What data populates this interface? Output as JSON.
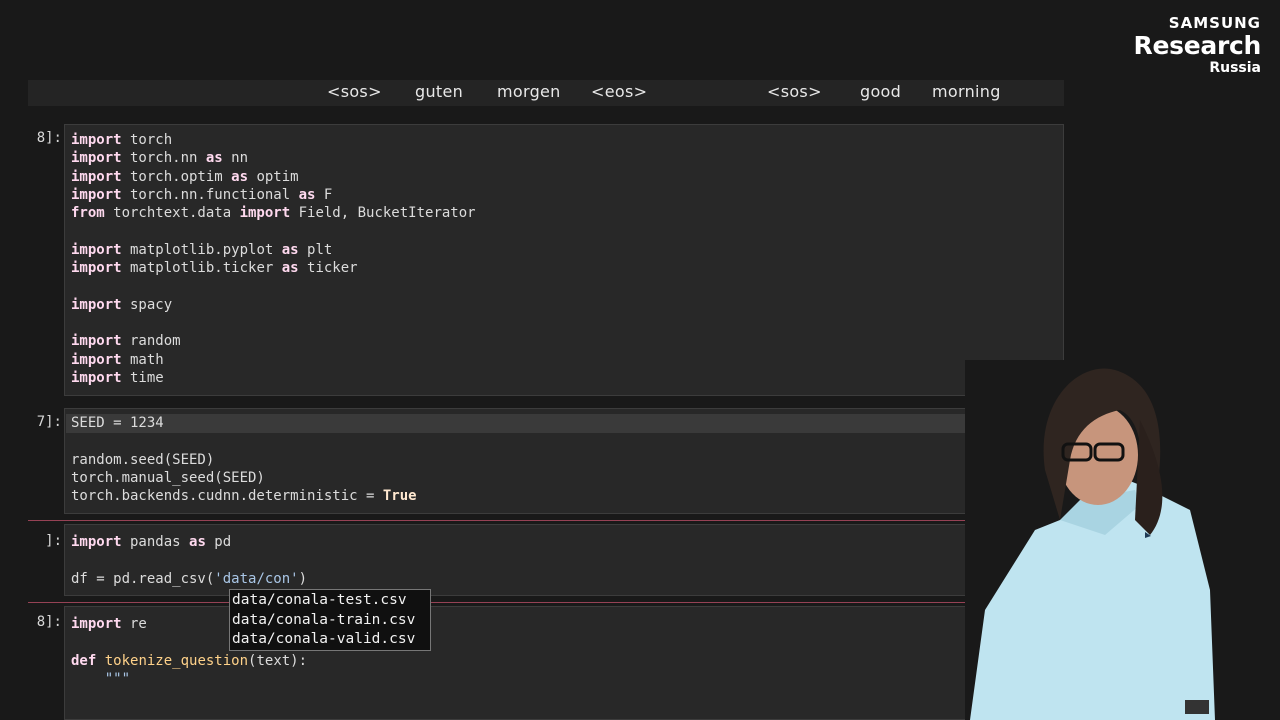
{
  "brand": {
    "line1": "SAMSUNG",
    "line2": "Research",
    "line3": "Russia"
  },
  "tokens": [
    "<sos>",
    "guten",
    "morgen",
    "<eos>",
    "<sos>",
    "good",
    "morning"
  ],
  "cells": [
    {
      "prompt": "8]:"
    },
    {
      "prompt": "7]:"
    },
    {
      "prompt": "]:"
    },
    {
      "prompt": "8]:"
    }
  ],
  "code": {
    "c1": [
      [
        "import",
        " torch"
      ],
      [
        "import",
        " torch.nn ",
        "as",
        " nn"
      ],
      [
        "import",
        " torch.optim ",
        "as",
        " optim"
      ],
      [
        "import",
        " torch.nn.functional ",
        "as",
        " F"
      ],
      [
        "from",
        " torchtext.data ",
        "import",
        " Field, BucketIterator"
      ],
      [
        "import",
        " matplotlib.pyplot ",
        "as",
        " plt"
      ],
      [
        "import",
        " matplotlib.ticker ",
        "as",
        " ticker"
      ],
      [
        "import",
        " spacy"
      ],
      [
        "import",
        " random"
      ],
      [
        "import",
        " math"
      ],
      [
        "import",
        " time"
      ]
    ],
    "c2": {
      "l1": "SEED = 1234",
      "l2": "random.seed(SEED)",
      "l3": "torch.manual_seed(SEED)",
      "l4a": "torch.backends.cudnn.deterministic = ",
      "l4b": "True"
    },
    "c3": {
      "l1a": "import",
      "l1b": " pandas ",
      "l1c": "as",
      "l1d": " pd",
      "l2a": "df = pd.read_csv(",
      "l2b": "'data/con'",
      "l2c": ")"
    },
    "c4": {
      "l1a": "import",
      "l1b": " re",
      "l2a": "def",
      "l2b": "tokenize_question",
      "l2c": "(text):",
      "l3": "\"\"\""
    }
  },
  "autocomplete": [
    "data/conala-test.csv",
    "data/conala-train.csv",
    "data/conala-valid.csv"
  ]
}
